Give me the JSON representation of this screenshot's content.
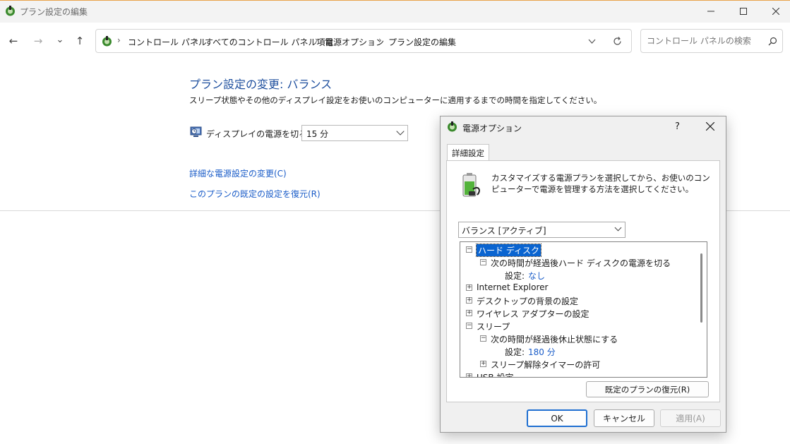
{
  "window": {
    "title": "プラン設定の編集",
    "minimize_icon": "minimize-icon",
    "maximize_icon": "maximize-icon",
    "close_icon": "close-icon"
  },
  "nav": {
    "back": "←",
    "forward": "→",
    "recent": "⌄",
    "up": "↑"
  },
  "address": {
    "crumbs": [
      "コントロール パネル",
      "すべてのコントロール パネル項目",
      "電源オプション",
      "プラン設定の編集"
    ],
    "separator": "›"
  },
  "search": {
    "placeholder": "コントロール パネルの検索"
  },
  "main": {
    "title": "プラン設定の変更: バランス",
    "description": "スリープ状態やその他のディスプレイ設定をお使いのコンピューターに適用するまでの時間を指定してください。",
    "display_off_label": "ディスプレイの電源を切る:",
    "display_off_value": "15 分",
    "link_advanced": "詳細な電源設定の変更(C)",
    "link_restore": "このプランの既定の設定を復元(R)"
  },
  "dialog": {
    "title": "電源オプション",
    "help": "?",
    "tab": "詳細設定",
    "intro": "カスタマイズする電源プランを選択してから、お使いのコンピューターで電源を管理する方法を選択してください。",
    "plan": "バランス [アクティブ]",
    "tree": [
      {
        "toggle": "⊟",
        "label": "ハード ディスク",
        "selected": true
      },
      {
        "toggle": "⊟",
        "label": "次の時間が経過後ハード ディスクの電源を切る"
      },
      {
        "label": "設定:",
        "value": "なし"
      },
      {
        "toggle": "⊞",
        "label": "Internet Explorer"
      },
      {
        "toggle": "⊞",
        "label": "デスクトップの背景の設定"
      },
      {
        "toggle": "⊞",
        "label": "ワイヤレス アダプターの設定"
      },
      {
        "toggle": "⊟",
        "label": "スリープ"
      },
      {
        "toggle": "⊟",
        "label": "次の時間が経過後休止状態にする"
      },
      {
        "label": "設定:",
        "value": "180 分"
      },
      {
        "toggle": "⊞",
        "label": "スリープ解除タイマーの許可"
      },
      {
        "toggle": "⊞",
        "label": "USB 設定"
      }
    ],
    "restore_button": "既定のプランの復元(R)",
    "ok": "OK",
    "cancel": "キャンセル",
    "apply": "適用(A)"
  },
  "colors": {
    "link": "#1a5cc8",
    "title": "#1e4f9e",
    "selection": "#0a64d0"
  }
}
